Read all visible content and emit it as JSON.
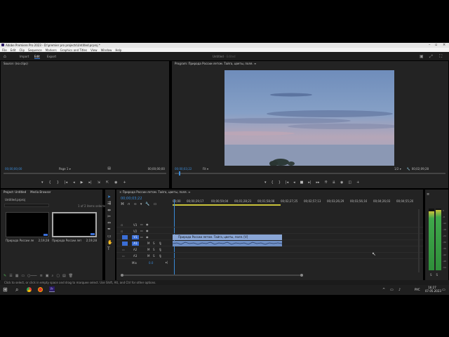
{
  "window": {
    "title": "Adobe Premiere Pro 2023 - D:\\premier pro projects\\Untitled.prproj *"
  },
  "menu": [
    "File",
    "Edit",
    "Clip",
    "Sequence",
    "Markers",
    "Graphics and Titles",
    "View",
    "Window",
    "Help"
  ],
  "workspace": {
    "tabs": [
      "Import",
      "Edit",
      "Export"
    ],
    "active": "Edit",
    "center_title": "Untitled",
    "center_sub": "- Edited"
  },
  "source": {
    "title": "Source: (no clips)",
    "timecode_left": "00;00;00;00",
    "page": "Page 1",
    "timecode_right": "00;00;00;00"
  },
  "program": {
    "title": "Program: Природа России летом. Тайга, цветы, поля. ",
    "timecode_left": "00;00;03;22",
    "fit": "Fit",
    "zoom": "1/2",
    "timecode_right": "00;02;09;28"
  },
  "project": {
    "tabs": [
      "Project: Untitled",
      "Media Browser"
    ],
    "file": "Untitled.prproj",
    "selected": "1 of 2 items selected",
    "items": [
      {
        "label": "Природа России летом...",
        "duration": "2;19;28"
      },
      {
        "label": "Природа России летом...",
        "duration": "2;19;28"
      }
    ]
  },
  "timeline": {
    "title": "Природа России летом. Тайга, цветы, поля. ",
    "timecode": "00;00;03;22",
    "ruler": [
      "00;00",
      "00;00;29;17",
      "00;00;59;04",
      "00;01;28;21",
      "00;01;58;08",
      "00;02;27;25",
      "00;02;57;13",
      "00;03;26;29",
      "00;03;56;16",
      "00;04;26;03",
      "00;04;55;20"
    ],
    "video_tracks": [
      "V3",
      "V2",
      "V1"
    ],
    "audio_tracks": [
      "A1",
      "A2",
      "A3"
    ],
    "mix_label": "Mix",
    "mix_value": "0.0",
    "clip_label": "Природа России летом. Тайга, цветы, поля. [V]",
    "clip_progress": 0.48,
    "clip_color": "#8aa6d6"
  },
  "meters": {
    "scale": [
      "0",
      "-6",
      "-12",
      "-18",
      "-24",
      "-30",
      "-36",
      "-42",
      "-48",
      "-54"
    ],
    "labels": [
      "S",
      "S"
    ]
  },
  "status": "Click to select, or click in empty space and drag to marquee select. Use Shift, Alt, and Ctrl for other options.",
  "taskbar": {
    "lang": "РУС",
    "time": "16:27",
    "date": "07.05.2023"
  }
}
